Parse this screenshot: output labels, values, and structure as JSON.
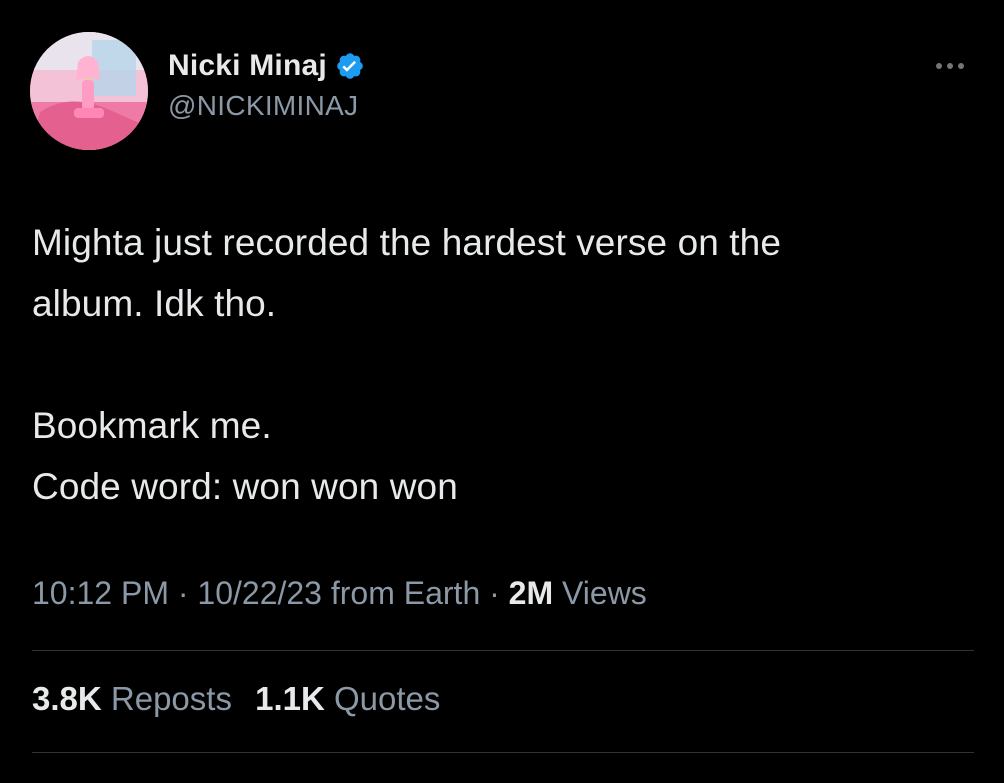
{
  "author": {
    "display_name": "Nicki Minaj",
    "handle": "@NICKIMINAJ",
    "verified": true,
    "verified_color": "#1d9bf0",
    "avatar_icon": "profile-photo"
  },
  "menu": {
    "icon": "more-options-icon"
  },
  "tweet": {
    "lines": [
      "Mighta just recorded the hardest verse on the",
      "album. Idk tho.",
      "",
      "Bookmark me.",
      "Code word: won won won"
    ]
  },
  "meta": {
    "time": "10:12 PM",
    "separator": "·",
    "date": "10/22/23",
    "source": "from Earth",
    "views_count": "2M",
    "views_label": "Views"
  },
  "stats": {
    "reposts_count": "3.8K",
    "reposts_label": "Reposts",
    "quotes_count": "1.1K",
    "quotes_label": "Quotes"
  },
  "colors": {
    "background": "#000000",
    "primary_text": "#e7e9ea",
    "secondary_text": "#8b98a5",
    "divider": "#2f3336"
  }
}
